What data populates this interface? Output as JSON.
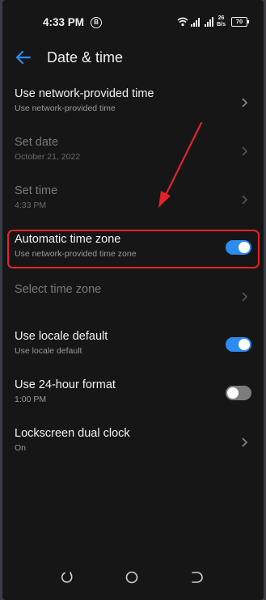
{
  "status_bar": {
    "time": "4:33 PM",
    "badge": "B",
    "net_speed_value": "26",
    "net_speed_unit": "B/s",
    "battery": "70"
  },
  "header": {
    "title": "Date & time",
    "back_icon": "arrow-left-icon"
  },
  "settings": [
    {
      "label": "Use network-provided time",
      "sublabel": "Use network-provided time",
      "control": "chevron",
      "enabled": true
    },
    {
      "label": "Set date",
      "sublabel": "October 21, 2022",
      "control": "chevron",
      "enabled": false
    },
    {
      "label": "Set time",
      "sublabel": "4:33 PM",
      "control": "chevron",
      "enabled": false
    },
    {
      "label": "Automatic time zone",
      "sublabel": "Use network-provided time zone",
      "control": "toggle",
      "state": "on",
      "highlighted": true
    },
    {
      "label": "Select time zone",
      "control": "chevron",
      "enabled": false
    },
    {
      "label": "Use locale default",
      "sublabel": "Use locale default",
      "control": "toggle",
      "state": "on"
    },
    {
      "label": "Use 24-hour format",
      "sublabel": "1:00 PM",
      "control": "toggle",
      "state": "off"
    },
    {
      "label": "Lockscreen dual clock",
      "sublabel": "On",
      "control": "chevron",
      "enabled": true
    }
  ],
  "nav_bar": {
    "items": [
      "recents-icon",
      "home-icon",
      "back-icon"
    ]
  },
  "colors": {
    "background": "#161616",
    "accent": "#2c8cf0",
    "highlight_annotation": "#e0242a"
  }
}
